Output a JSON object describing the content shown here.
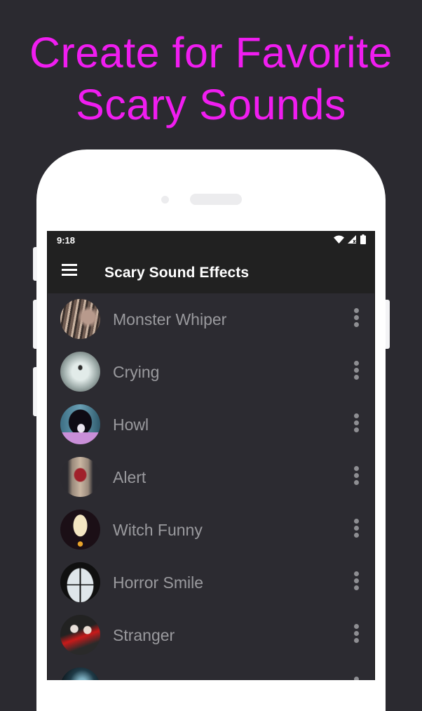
{
  "promo": {
    "line1": "Create for Favorite",
    "line2": "Scary Sounds",
    "color": "#f01df0"
  },
  "status_bar": {
    "time": "9:18",
    "icons": [
      "wifi-icon",
      "signal-icon",
      "battery-icon"
    ]
  },
  "toolbar": {
    "menu_icon": "hamburger-menu-icon",
    "title": "Scary Sound Effects"
  },
  "sounds": [
    {
      "label": "Monster Whiper",
      "thumb": "creepy-hair-face"
    },
    {
      "label": "Crying",
      "thumb": "ghost-on-foggy-sky"
    },
    {
      "label": "Howl",
      "thumb": "anime-ghost-girl"
    },
    {
      "label": "Alert",
      "thumb": "red-oni-mask"
    },
    {
      "label": "Witch Funny",
      "thumb": "no-face-spirit"
    },
    {
      "label": "Horror Smile",
      "thumb": "figure-at-window"
    },
    {
      "label": "Stranger",
      "thumb": "skeleton-couple"
    },
    {
      "label": "",
      "thumb": "dark-room"
    }
  ],
  "row_action_icon": "more-vertical-icon"
}
